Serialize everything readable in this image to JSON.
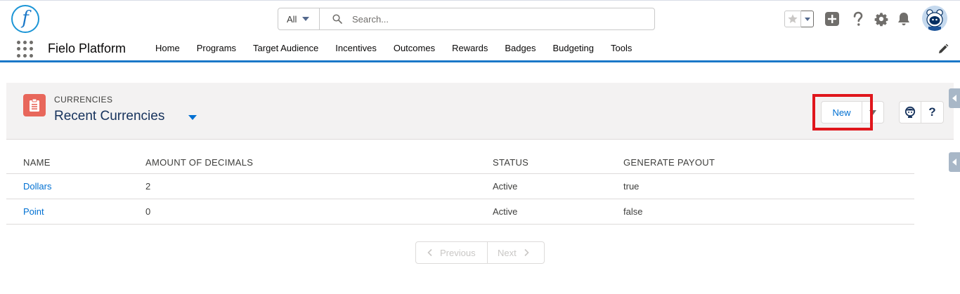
{
  "header": {
    "logo_letter": "f",
    "search": {
      "scope": "All",
      "placeholder": "Search..."
    }
  },
  "nav": {
    "app_name": "Fielo Platform",
    "items": [
      "Home",
      "Programs",
      "Target Audience",
      "Incentives",
      "Outcomes",
      "Rewards",
      "Badges",
      "Budgeting",
      "Tools"
    ]
  },
  "list_view": {
    "object_label": "CURRENCIES",
    "title": "Recent Currencies",
    "new_button": "New",
    "help_label": "?"
  },
  "table": {
    "columns": [
      "NAME",
      "AMOUNT OF DECIMALS",
      "STATUS",
      "GENERATE PAYOUT"
    ],
    "rows": [
      {
        "name": "Dollars",
        "decimals": "2",
        "status": "Active",
        "payout": "true"
      },
      {
        "name": "Point",
        "decimals": "0",
        "status": "Active",
        "payout": "false"
      }
    ]
  },
  "pagination": {
    "previous": "Previous",
    "next": "Next"
  },
  "colors": {
    "brand": "#0070d2",
    "nav_accent": "#1b78c8",
    "object_icon": "#e8675b",
    "highlight": "#e0161c"
  }
}
